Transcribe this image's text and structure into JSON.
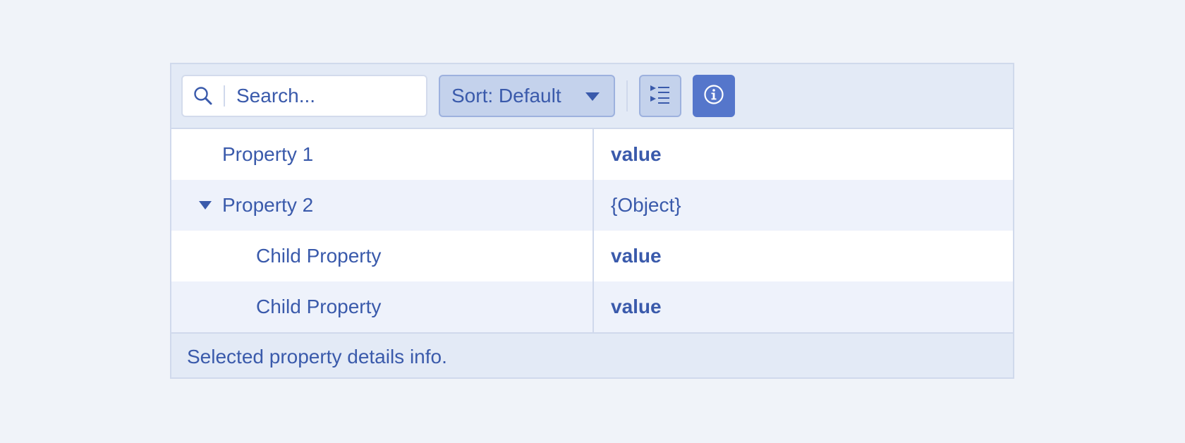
{
  "toolbar": {
    "search": {
      "placeholder": "Search...",
      "value": "",
      "icon": "search-icon"
    },
    "sort": {
      "label": "Sort: Default",
      "icon": "chevron-down-icon"
    },
    "tree_toggle": {
      "icon": "expand-tree-icon"
    },
    "info": {
      "icon": "info-icon"
    }
  },
  "rows": [
    {
      "property": "Property 1",
      "value": "value",
      "expanded": null,
      "level": 0
    },
    {
      "property": "Property 2",
      "value": "{Object}",
      "expanded": true,
      "level": 0
    },
    {
      "property": "Child Property",
      "value": "value",
      "expanded": null,
      "level": 1
    },
    {
      "property": "Child Property",
      "value": "value",
      "expanded": null,
      "level": 1
    }
  ],
  "footer": {
    "text": "Selected property details info."
  },
  "colors": {
    "accent": "#5576cb",
    "text": "#3a5aab",
    "background": "#f0f3f9",
    "toolbar_bg": "#e3eaf6",
    "row_alt": "#eef2fb"
  }
}
